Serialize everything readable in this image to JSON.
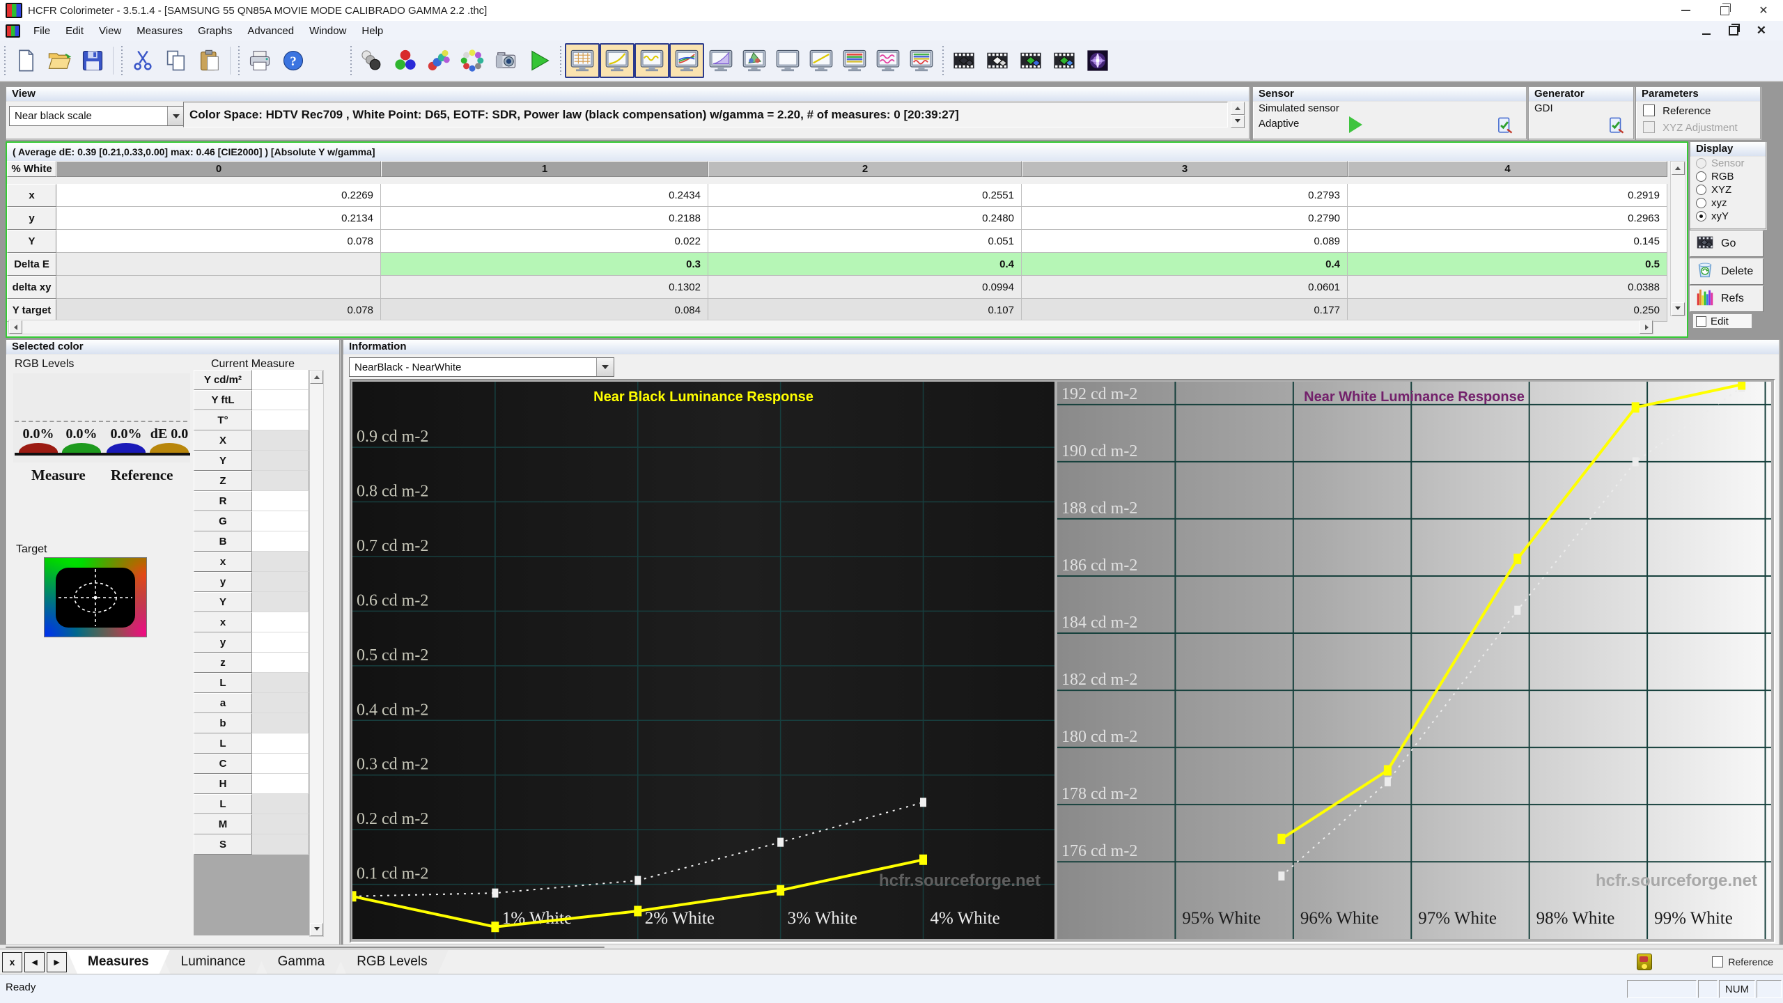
{
  "window": {
    "title": "HCFR Colorimeter - 3.5.1.4 - [SAMSUNG 55 QN85A MOVIE MODE CALIBRADO GAMMA 2.2 .thc]"
  },
  "menu": {
    "items": [
      "File",
      "Edit",
      "View",
      "Measures",
      "Graphs",
      "Advanced",
      "Window",
      "Help"
    ]
  },
  "toolbar": {
    "groups": [
      {
        "name": "file",
        "buttons": [
          {
            "name": "new-file-button",
            "icon": "doc-new"
          },
          {
            "name": "open-file-button",
            "icon": "folder-open"
          },
          {
            "name": "save-button",
            "icon": "save"
          }
        ]
      },
      {
        "name": "clipboard",
        "buttons": [
          {
            "name": "cut-button",
            "icon": "cut"
          },
          {
            "name": "copy-button",
            "icon": "copy"
          },
          {
            "name": "paste-button",
            "icon": "paste"
          }
        ]
      },
      {
        "name": "output",
        "buttons": [
          {
            "name": "print-button",
            "icon": "print"
          },
          {
            "name": "help-button",
            "icon": "help"
          }
        ]
      },
      {
        "name": "measure",
        "buttons": [
          {
            "name": "measure-grayscale-button",
            "icon": "balls-gray"
          },
          {
            "name": "measure-primaries-button",
            "icon": "balls-rgb"
          },
          {
            "name": "measure-secondaries-button",
            "icon": "balls-arc"
          },
          {
            "name": "measure-all-colors-button",
            "icon": "balls-ring"
          },
          {
            "name": "capture-single-measure-button",
            "icon": "camera"
          },
          {
            "name": "run-continuous-measures-button",
            "icon": "play"
          }
        ]
      },
      {
        "name": "views",
        "buttons": [
          {
            "name": "view-measures-grid-button",
            "icon": "mon-table",
            "active": true
          },
          {
            "name": "view-gamma-curve-button",
            "icon": "mon-gamma",
            "active": true
          },
          {
            "name": "view-luminance-curve-button",
            "icon": "mon-wave",
            "active": true
          },
          {
            "name": "view-rgb-curves-button",
            "icon": "mon-rgbcurves",
            "active": true
          },
          {
            "name": "view-violet-curve-button",
            "icon": "mon-violet"
          },
          {
            "name": "view-cie-gamut-button",
            "icon": "mon-gamut"
          },
          {
            "name": "view-blank-button",
            "icon": "mon-blank"
          },
          {
            "name": "view-yellow-line-button",
            "icon": "mon-yline"
          },
          {
            "name": "view-color-stripes-button",
            "icon": "mon-stripes"
          },
          {
            "name": "view-magenta-waves-button",
            "icon": "mon-pinkwaves"
          },
          {
            "name": "view-stripes-wave-button",
            "icon": "mon-stripes2"
          }
        ]
      },
      {
        "name": "sequence",
        "buttons": [
          {
            "name": "film-dark-button",
            "icon": "film-dark"
          },
          {
            "name": "film-light-button",
            "icon": "film-light"
          },
          {
            "name": "film-color-primary-button",
            "icon": "film-color"
          },
          {
            "name": "film-color-secondary-button",
            "icon": "film-color2"
          },
          {
            "name": "galaxy-pattern-button",
            "icon": "galaxy"
          }
        ]
      }
    ]
  },
  "view": {
    "caption": "View",
    "scale_value": "Near black scale",
    "info": "Color Space: HDTV Rec709 , White Point: D65, EOTF:  SDR, Power law (black compensation) w/gamma = 2.20, # of measures: 0 [20:39:27]"
  },
  "sensor": {
    "caption": "Sensor",
    "line1": "Simulated sensor",
    "line2": "Adaptive"
  },
  "generator": {
    "caption": "Generator",
    "value": "GDI"
  },
  "parameters": {
    "caption": "Parameters",
    "reference_label": "Reference",
    "xyz_label": "XYZ Adjustment"
  },
  "measures": {
    "summary": "( Average dE: 0.39 [0.21,0.33,0.00] max: 0.46 [CIE2000] ) [Absolute Y w/gamma]",
    "row_header": "% White",
    "columns": [
      "0",
      "1",
      "2",
      "3",
      "4"
    ],
    "rows": [
      {
        "label": "x",
        "values": [
          "0.2269",
          "0.2434",
          "0.2551",
          "0.2793",
          "0.2919"
        ]
      },
      {
        "label": "y",
        "values": [
          "0.2134",
          "0.2188",
          "0.2480",
          "0.2790",
          "0.2963"
        ]
      },
      {
        "label": "Y",
        "values": [
          "0.078",
          "0.022",
          "0.051",
          "0.089",
          "0.145"
        ]
      },
      {
        "label": "Delta E",
        "values": [
          "",
          "0.3",
          "0.4",
          "0.4",
          "0.5"
        ],
        "highlight": true
      },
      {
        "label": "delta xy",
        "values": [
          "",
          "0.1302",
          "0.0994",
          "0.0601",
          "0.0388"
        ]
      },
      {
        "label": "Y target",
        "values": [
          "0.078",
          "0.084",
          "0.107",
          "0.177",
          "0.250"
        ]
      }
    ],
    "delta_e_highlight_color": "#b6f6b6",
    "selection_border_color": "#35cb35"
  },
  "display": {
    "caption": "Display",
    "options": [
      {
        "label": "Sensor",
        "disabled": true
      },
      {
        "label": "RGB"
      },
      {
        "label": "XYZ"
      },
      {
        "label": "xyz"
      },
      {
        "label": "xyY",
        "selected": true
      }
    ],
    "buttons": [
      {
        "label": "Go",
        "icon": "go"
      },
      {
        "label": "Delete",
        "icon": "delete"
      },
      {
        "label": "Refs",
        "icon": "refs"
      }
    ],
    "edit_label": "Edit"
  },
  "selected_color": {
    "caption": "Selected color",
    "rgb_levels_label": "RGB Levels",
    "current_measure_label": "Current Measure",
    "bars": [
      {
        "label": "0.0%",
        "color": "#9b1b12"
      },
      {
        "label": "0.0%",
        "color": "#1e9a1e"
      },
      {
        "label": "0.0%",
        "color": "#1a1ab8"
      },
      {
        "label": "dE 0.0",
        "color": "#b8860b"
      }
    ],
    "measure_label": "Measure",
    "reference_label": "Reference",
    "target_label": "Target",
    "measure_rows": [
      "Y cd/m²",
      "Y ftL",
      "T°",
      "X",
      "Y",
      "Z",
      "R",
      "G",
      "B",
      "x",
      "y",
      "Y",
      "x",
      "y",
      "z",
      "L",
      "a",
      "b",
      "L",
      "C",
      "H",
      "L",
      "M",
      "S"
    ]
  },
  "information": {
    "caption": "Information",
    "selector_value": "NearBlack - NearWhite"
  },
  "chart_data": [
    {
      "type": "line",
      "title": "Near Black Luminance Response",
      "xlabel_unit": "% White",
      "xticks": [
        1,
        2,
        3,
        4
      ],
      "xticklabels": [
        "1% White",
        "2% White",
        "3% White",
        "4% White"
      ],
      "yticks": [
        0.1,
        0.2,
        0.3,
        0.4,
        0.5,
        0.6,
        0.7,
        0.8,
        0.9
      ],
      "yticklabels": [
        "0.1 cd m-2",
        "0.2 cd m-2",
        "0.3 cd m-2",
        "0.4 cd m-2",
        "0.5 cd m-2",
        "0.6 cd m-2",
        "0.7 cd m-2",
        "0.8 cd m-2",
        "0.9 cd m-2"
      ],
      "xlim": [
        0,
        4.92
      ],
      "ylim": [
        0,
        1.02
      ],
      "series": [
        {
          "name": "measured luminance",
          "color": "#ffff00",
          "style": "solid",
          "x": [
            0,
            1,
            2,
            3,
            4
          ],
          "y": [
            0.078,
            0.022,
            0.051,
            0.089,
            0.145
          ]
        },
        {
          "name": "reference (Y target)",
          "color": "#f0f0f0",
          "style": "dashed",
          "x": [
            0,
            1,
            2,
            3,
            4
          ],
          "y": [
            0.078,
            0.084,
            0.107,
            0.177,
            0.25
          ]
        }
      ],
      "grid": true,
      "watermark": "hcfr.sourceforge.net"
    },
    {
      "type": "line",
      "title": "Near White Luminance Response",
      "xlabel_unit": "% White",
      "xticks": [
        95,
        96,
        97,
        98,
        99,
        100
      ],
      "xticklabels": [
        "95% White",
        "96% White",
        "97% White",
        "98% White",
        "99% White",
        ""
      ],
      "yticks": [
        176,
        178,
        180,
        182,
        184,
        186,
        188,
        190,
        192
      ],
      "yticklabels": [
        "176 cd m-2",
        "178 cd m-2",
        "180 cd m-2",
        "182 cd m-2",
        "184 cd m-2",
        "186 cd m-2",
        "188 cd m-2",
        "190 cd m-2",
        "192 cd m-2"
      ],
      "xlim": [
        94.0,
        100.05
      ],
      "ylim": [
        173.3,
        192.8
      ],
      "series": [
        {
          "name": "measured luminance",
          "color": "#ffff00",
          "style": "solid",
          "x": [
            95.9,
            96.8,
            97.9,
            98.9,
            99.8
          ],
          "y": [
            176.8,
            179.2,
            186.6,
            191.9,
            192.7
          ]
        },
        {
          "name": "reference",
          "color": "#ececec",
          "style": "dashed",
          "x": [
            95.9,
            96.8,
            97.9,
            98.9,
            99.8
          ],
          "y": [
            175.5,
            178.8,
            184.8,
            190.0,
            192.6
          ]
        }
      ],
      "grid": true,
      "watermark": "hcfr.sourceforge.net"
    }
  ],
  "tabs": {
    "nav_buttons": [
      "x",
      "◄",
      "►"
    ],
    "items": [
      "Measures",
      "Luminance",
      "Gamma",
      "RGB Levels"
    ],
    "active": "Measures",
    "reference_label": "Reference"
  },
  "status": {
    "ready": "Ready",
    "panes": [
      "",
      "",
      "NUM",
      ""
    ]
  }
}
